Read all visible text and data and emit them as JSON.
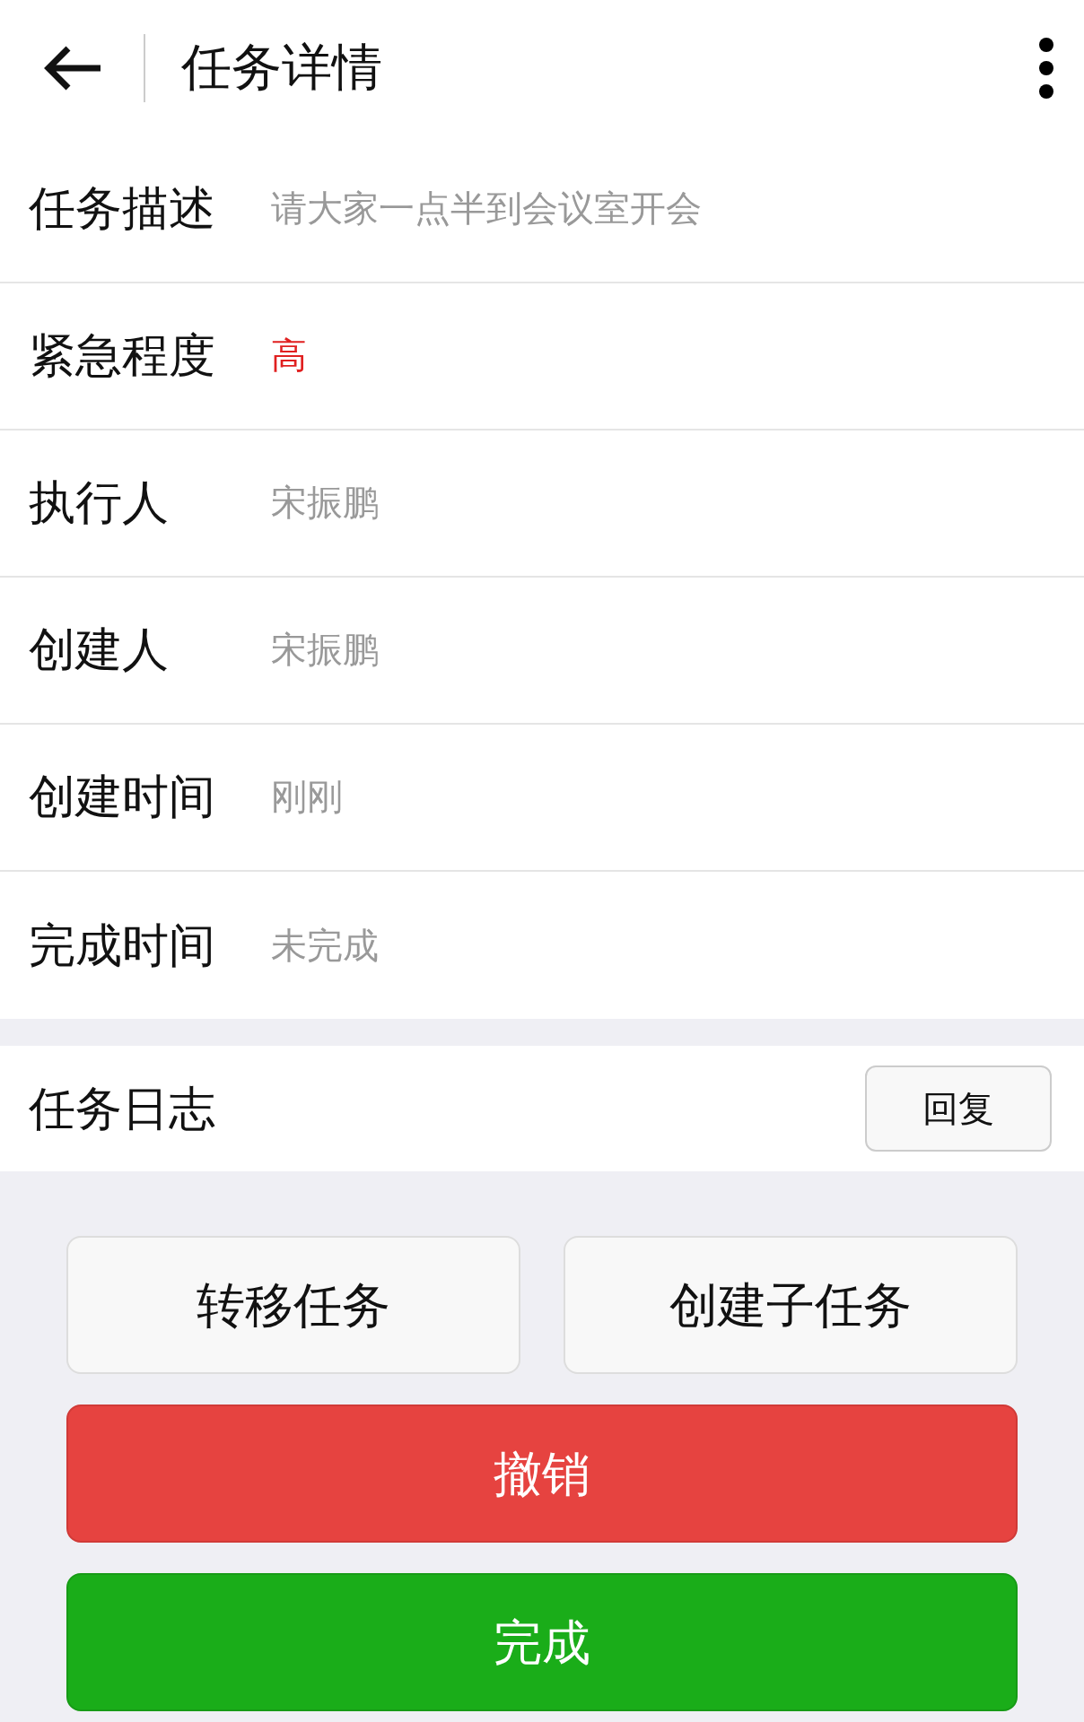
{
  "header": {
    "title": "任务详情"
  },
  "fields": [
    {
      "label": "任务描述",
      "value": "请大家一点半到会议室开会",
      "kind": "plain"
    },
    {
      "label": "紧急程度",
      "value": "高",
      "kind": "alert"
    },
    {
      "label": "执行人",
      "value": "宋振鹏",
      "kind": "plain"
    },
    {
      "label": "创建人",
      "value": "宋振鹏",
      "kind": "plain"
    },
    {
      "label": "创建时间",
      "value": "刚刚",
      "kind": "plain"
    },
    {
      "label": "完成时间",
      "value": "未完成",
      "kind": "plain"
    }
  ],
  "log": {
    "title": "任务日志",
    "reply_button": "回复"
  },
  "actions": [
    {
      "label": "转移任务",
      "kind": "secondary"
    },
    {
      "label": "创建子任务",
      "kind": "secondary"
    },
    {
      "label": "撤销",
      "kind": "danger"
    },
    {
      "label": "完成",
      "kind": "primary"
    }
  ]
}
